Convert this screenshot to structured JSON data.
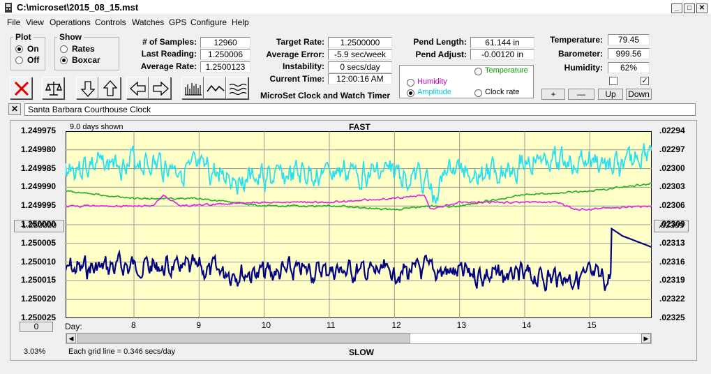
{
  "window": {
    "title": "C:\\microset\\2015_08_15.mst",
    "buttons": [
      "_",
      "□",
      "✕"
    ]
  },
  "menu": [
    "File",
    "View",
    "Operations",
    "Controls",
    "Watches",
    "GPS",
    "Configure",
    "Help"
  ],
  "plot_group": {
    "title": "Plot",
    "options": [
      {
        "label": "On",
        "selected": true
      },
      {
        "label": "Off",
        "selected": false
      }
    ]
  },
  "show_group": {
    "title": "Show",
    "options": [
      {
        "label": "Rates",
        "selected": false
      },
      {
        "label": "Boxcar",
        "selected": true
      }
    ]
  },
  "stats": {
    "samples_label": "# of Samples:",
    "samples": "12960",
    "last_label": "Last Reading:",
    "last": "1.250006",
    "avg_rate_label": "Average Rate:",
    "avg_rate": "1.2500123",
    "target_label": "Target Rate:",
    "target": "1.2500000",
    "avg_error_label": "Average Error:",
    "avg_error": "-5.9 sec/week",
    "instability_label": "Instability:",
    "instability": "0 secs/day",
    "time_label": "Current Time:",
    "time": "12:00:16 AM",
    "pend_length_label": "Pend Length:",
    "pend_length": "61.144 in",
    "pend_adjust_label": "Pend Adjust:",
    "pend_adjust": "-0.00120 in",
    "temperature_label": "Temperature:",
    "temperature": "79.45",
    "barometer_label": "Barometer:",
    "barometer": "999.56",
    "humidity_label": "Humidity:",
    "humidity": "62%"
  },
  "app_name": "MicroSet Clock and Watch Timer",
  "secondary_plot": {
    "options": [
      {
        "label": "Temperature",
        "color": "#00a000",
        "selected": false
      },
      {
        "label": "Humidity",
        "color": "#c000c0",
        "selected": false
      },
      {
        "label": "Amplitude",
        "color": "#00c8e8",
        "selected": true
      },
      {
        "label": "Clock rate",
        "color": "#000000",
        "selected": false
      }
    ]
  },
  "right_checks": [
    false,
    true
  ],
  "right_buttons": [
    "+",
    "—",
    "Up",
    "Down"
  ],
  "clock_name": "Santa Barbara Courthouse Clock",
  "chart": {
    "days_shown": "9.0 days shown",
    "top_label": "FAST",
    "bottom_label": "SLOW",
    "day_label": "Day:",
    "grid_note": "Each grid line = 0.346 secs/day",
    "percent": "3.03%",
    "left_center_button": "1.250000",
    "left_bottom_button": "0",
    "right_center_button": ".02309"
  },
  "chart_data": {
    "type": "line",
    "left_axis_ticks": [
      "1.249975",
      "1.249980",
      "1.249985",
      "1.249990",
      "1.249995",
      "1.250000",
      "1.250005",
      "1.250010",
      "1.250015",
      "1.250020",
      "1.250025"
    ],
    "right_axis_ticks": [
      ".02294",
      ".02297",
      ".02300",
      ".02303",
      ".02306",
      ".02309",
      ".02313",
      ".02316",
      ".02319",
      ".02322",
      ".02325"
    ],
    "x_ticks": [
      "8",
      "9",
      "10",
      "11",
      "12",
      "13",
      "14",
      "15"
    ],
    "x_range": [
      6.95,
      15.95
    ],
    "left_ylim": [
      1.249975,
      1.250025
    ],
    "right_ylim": [
      0.02294,
      0.02325
    ],
    "grid": true,
    "colors": {
      "plot_bg": "#ffffc8",
      "grid": "#9a9a9a",
      "rate": "#000080",
      "amplitude": "#28e0f0",
      "temperature": "#20b020",
      "humidity": "#e020e0"
    },
    "series": [
      {
        "color_key": "rate",
        "seed": 7,
        "noise": 2.4e-06,
        "knots": [
          [
            6.95,
            1.250012
          ],
          [
            8.0,
            1.250011
          ],
          [
            9.0,
            1.250012
          ],
          [
            10.0,
            1.250013
          ],
          [
            11.0,
            1.250012
          ],
          [
            12.0,
            1.250013
          ],
          [
            12.5,
            1.250012
          ],
          [
            13.0,
            1.250013
          ],
          [
            14.0,
            1.250014
          ],
          [
            15.0,
            1.250014
          ],
          [
            15.3,
            1.250015
          ],
          [
            15.32,
            1.250013
          ],
          [
            15.33,
            1.250001
          ],
          [
            15.5,
            1.250003
          ],
          [
            15.8,
            1.250005
          ],
          [
            15.95,
            1.250006
          ]
        ],
        "noise_until": 15.3
      },
      {
        "color_key": "amplitude",
        "seed": 3,
        "noise": 2.8e-06,
        "knots": [
          [
            6.95,
            1.249985
          ],
          [
            8.0,
            1.249983
          ],
          [
            9.0,
            1.249986
          ],
          [
            10.0,
            1.249988
          ],
          [
            11.0,
            1.249986
          ],
          [
            12.0,
            1.249986
          ],
          [
            12.5,
            1.249988
          ],
          [
            12.6,
            1.249994
          ],
          [
            12.8,
            1.249985
          ],
          [
            13.5,
            1.249986
          ],
          [
            14.0,
            1.249983
          ],
          [
            15.0,
            1.249983
          ],
          [
            15.5,
            1.249985
          ],
          [
            15.95,
            1.249979
          ]
        ],
        "noise_until": 15.95
      },
      {
        "color_key": "temperature",
        "seed": 11,
        "noise": 2e-07,
        "knots": [
          [
            6.95,
            1.249991
          ],
          [
            8.0,
            1.249993
          ],
          [
            9.0,
            1.249993
          ],
          [
            10.0,
            1.249995
          ],
          [
            11.0,
            1.249995
          ],
          [
            12.0,
            1.249996
          ],
          [
            12.5,
            1.249995
          ],
          [
            13.0,
            1.249995
          ],
          [
            14.0,
            1.249992
          ],
          [
            15.0,
            1.249991
          ],
          [
            15.95,
            1.249989
          ]
        ],
        "noise_until": 15.95
      },
      {
        "color_key": "humidity",
        "seed": 19,
        "noise": 2e-07,
        "knots": [
          [
            6.95,
            1.249995
          ],
          [
            8.3,
            1.249995
          ],
          [
            8.45,
            1.249992
          ],
          [
            8.7,
            1.249995
          ],
          [
            10.0,
            1.249994
          ],
          [
            11.0,
            1.249994
          ],
          [
            12.0,
            1.249993
          ],
          [
            12.45,
            1.249992
          ],
          [
            12.55,
            1.249996
          ],
          [
            13.0,
            1.249994
          ],
          [
            14.0,
            1.249994
          ],
          [
            14.5,
            1.249994
          ],
          [
            14.8,
            1.249996
          ],
          [
            15.95,
            1.249995
          ]
        ],
        "noise_until": 15.95
      }
    ]
  }
}
